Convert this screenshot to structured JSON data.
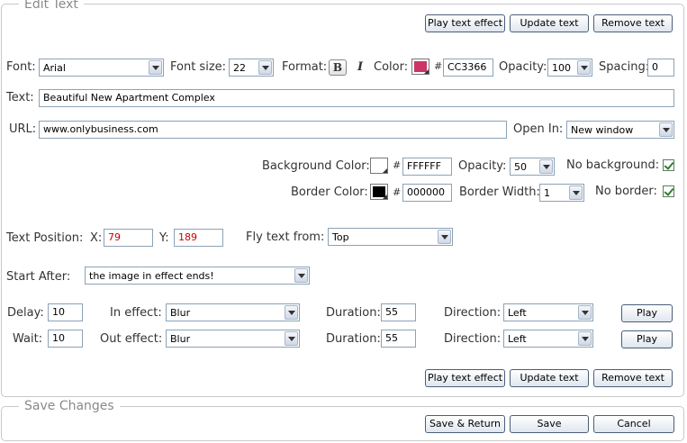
{
  "edit_text": {
    "legend": "Edit Text",
    "top_buttons": {
      "play": "Play text effect",
      "update": "Update text",
      "remove": "Remove text"
    },
    "font": {
      "label": "Font:",
      "value": "Arial"
    },
    "font_size": {
      "label": "Font size:",
      "value": "22"
    },
    "format": {
      "label": "Format:",
      "bold": "B",
      "italic": "I"
    },
    "color": {
      "label": "Color:",
      "hash": "#",
      "value": "CC3366",
      "swatch": "#cc3366"
    },
    "opacity": {
      "label": "Opacity:",
      "value": "100"
    },
    "spacing": {
      "label": "Spacing:",
      "value": "0"
    },
    "text": {
      "label": "Text:",
      "value": "Beautiful New Apartment Complex"
    },
    "url": {
      "label": "URL:",
      "value": "www.onlybusiness.com"
    },
    "open_in": {
      "label": "Open In:",
      "value": "New window"
    },
    "background": {
      "label": "Background Color:",
      "hash": "#",
      "value": "FFFFFF",
      "swatch": "#ffffff",
      "opacity_label": "Opacity:",
      "opacity_value": "50",
      "none_label": "No background:",
      "none_checked": true
    },
    "border": {
      "label": "Border Color:",
      "hash": "#",
      "value": "000000",
      "swatch": "#000000",
      "width_label": "Border Width:",
      "width_value": "1",
      "none_label": "No border:",
      "none_checked": true
    },
    "position": {
      "label": "Text Position:",
      "x_label": "X:",
      "x_value": "79",
      "y_label": "Y:",
      "y_value": "189"
    },
    "fly": {
      "label": "Fly text from:",
      "value": "Top"
    },
    "start_after": {
      "label": "Start After:",
      "value": "the image in effect ends!"
    },
    "delay": {
      "label": "Delay:",
      "value": "10"
    },
    "in_effect": {
      "label": "In effect:",
      "value": "Blur",
      "duration_label": "Duration:",
      "duration_value": "55",
      "direction_label": "Direction:",
      "direction_value": "Left",
      "play": "Play"
    },
    "wait": {
      "label": "Wait:",
      "value": "10"
    },
    "out_effect": {
      "label": "Out effect:",
      "value": "Blur",
      "duration_label": "Duration:",
      "duration_value": "55",
      "direction_label": "Direction:",
      "direction_value": "Left",
      "play": "Play"
    },
    "bottom_buttons": {
      "play": "Play text effect",
      "update": "Update text",
      "remove": "Remove text"
    }
  },
  "save_changes": {
    "legend": "Save Changes",
    "save_return": "Save & Return",
    "save": "Save",
    "cancel": "Cancel"
  }
}
